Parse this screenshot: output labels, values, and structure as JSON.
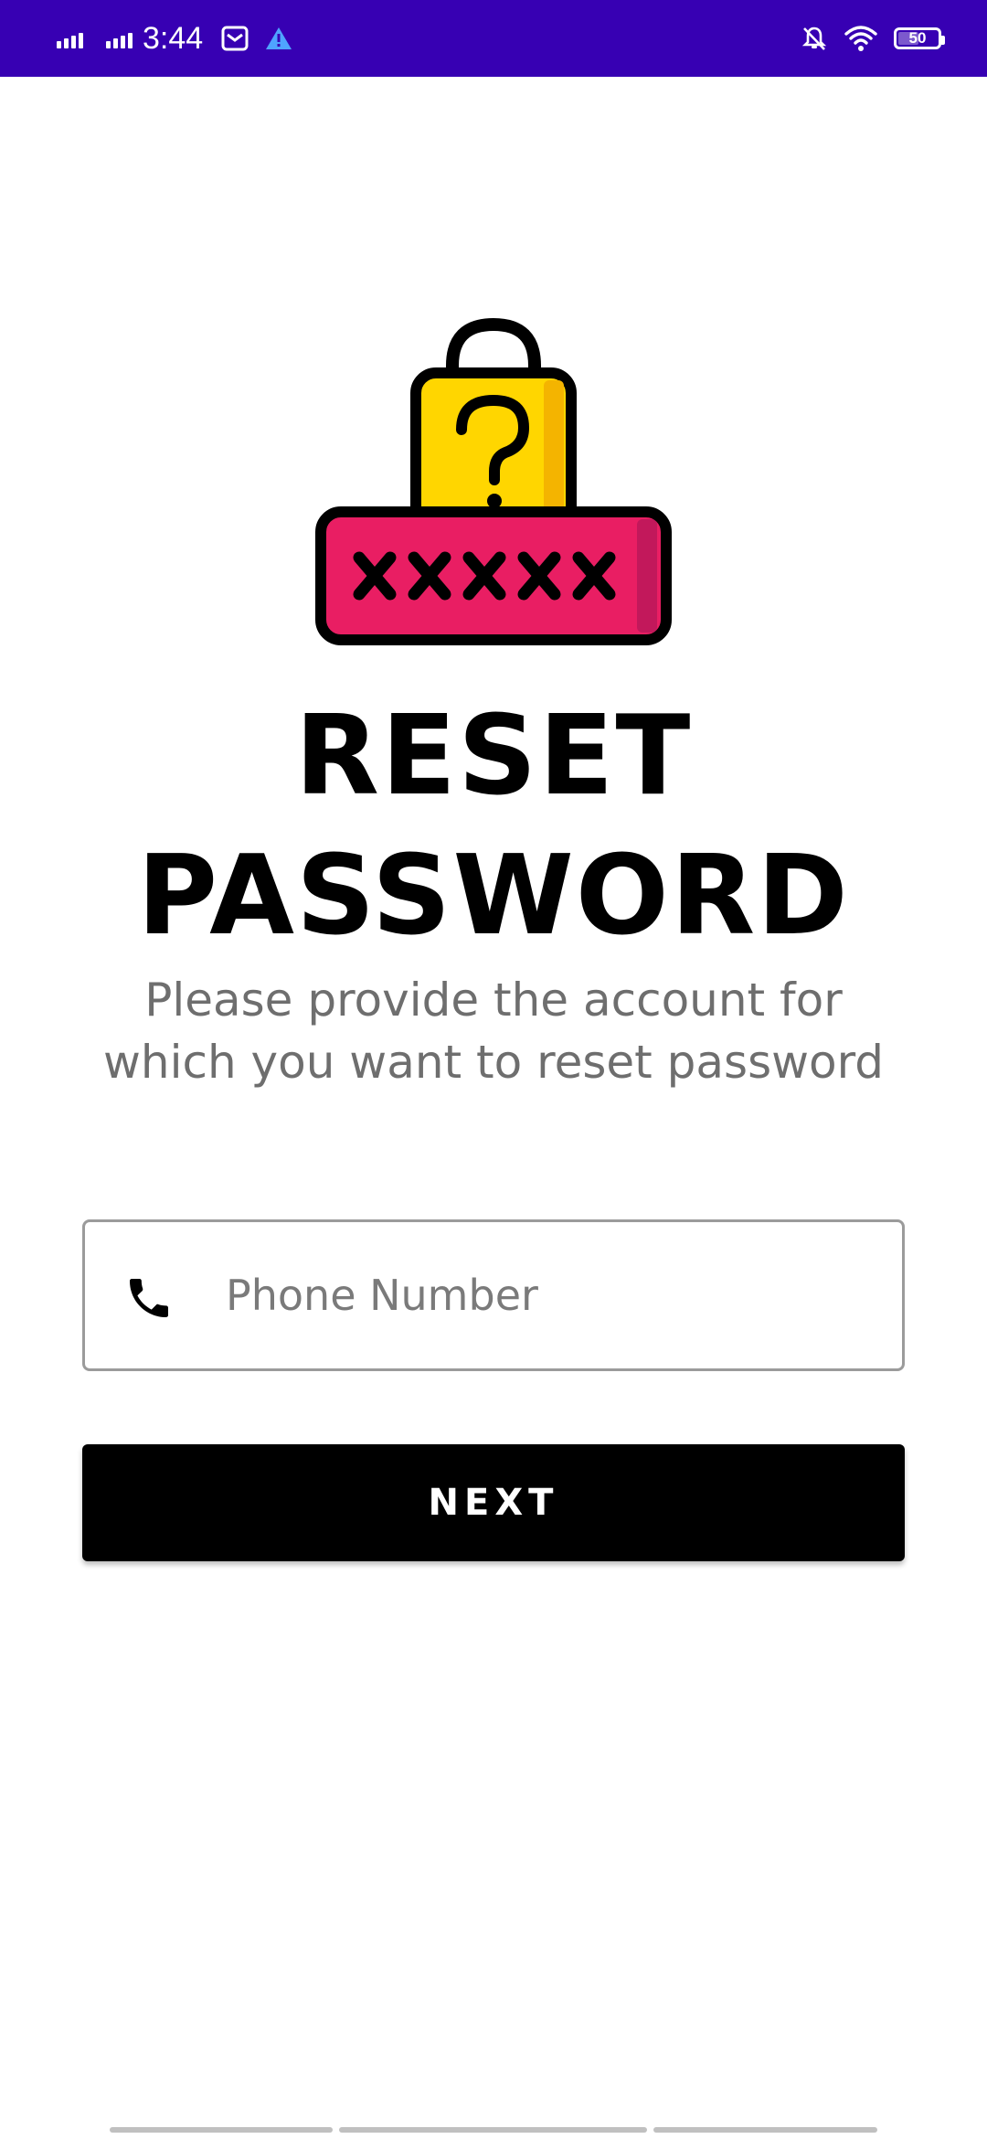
{
  "status_bar": {
    "time": "3:44",
    "battery_level": "50",
    "icons": [
      "signal-icon",
      "signal-icon",
      "email-icon",
      "alert-icon",
      "mute-icon",
      "wifi-icon",
      "battery-icon"
    ],
    "background_color": "#3700b3"
  },
  "illustration": {
    "name": "padlock-question-password",
    "lock_color": "#ffd600",
    "bar_color": "#e91e63",
    "mask": "XXXXX"
  },
  "header": {
    "title_line1": "RESET",
    "title_line2": "PASSWORD",
    "subtitle": "Please provide the account for which you want to reset password"
  },
  "form": {
    "phone_placeholder": "Phone Number",
    "phone_value": "",
    "phone_icon": "phone-icon",
    "next_label": "NEXT",
    "button_color": "#000000"
  }
}
